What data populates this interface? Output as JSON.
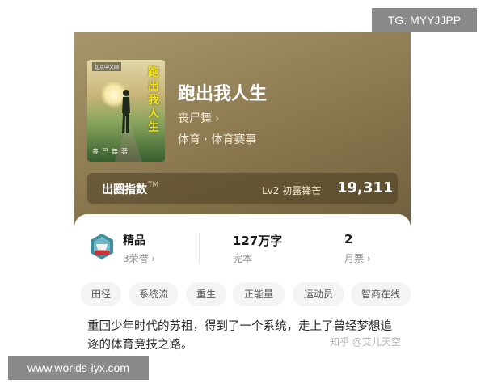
{
  "watermarks": {
    "top_right": "TG: MYYJJPP",
    "bottom_left": "www.worlds-iyx.com",
    "zhihu": "知乎 @艾儿天空"
  },
  "book": {
    "cover": {
      "publisher_text": "起点中文网",
      "title_text": "跑出我人生",
      "author_text": "丧尸舞著"
    },
    "title": "跑出我人生",
    "author": "丧尸舞",
    "category": "体育 · 体育赛事"
  },
  "index_bar": {
    "label": "出圈指数",
    "tm": "TM",
    "level": "Lv2 初露锋芒",
    "value": "19,311"
  },
  "stats": {
    "badge": {
      "main": "精品",
      "sub": "3荣誉"
    },
    "words": {
      "main": "127万字",
      "sub": "完本"
    },
    "votes": {
      "main": "2",
      "sub": "月票"
    }
  },
  "tags": [
    "田径",
    "系统流",
    "重生",
    "正能量",
    "运动员",
    "智商在线"
  ],
  "description": "重回少年时代的苏祖，得到了一个系统，走上了曾经梦想追逐的体育竞技之路。",
  "colors": {
    "hero_gold": "#8f7c53",
    "cover_title_yellow": "#f3e31b",
    "badge_blue": "#3e8e9d",
    "badge_red": "#c8323a"
  },
  "icons": [
    "chevron-right-icon",
    "honor-badge-icon"
  ]
}
